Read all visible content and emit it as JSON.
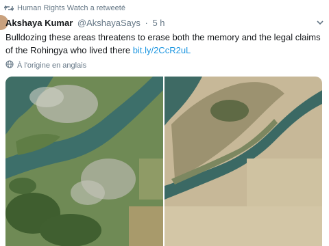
{
  "retweet_context": "Human Rights Watch a retweeté",
  "author": {
    "name": "Akshaya Kumar",
    "handle": "@AkshayaSays",
    "separator": "·",
    "time": "5 h"
  },
  "tweet": {
    "text": "Bulldozing these areas threatens to erase both the memory and the legal claims of the Rohingya who lived there ",
    "link": "bit.ly/2CcR2uL"
  },
  "translation_label": "À l'origine en anglais",
  "media": {
    "images": [
      "satellite-before",
      "satellite-after"
    ]
  },
  "icons": {
    "retweet": "retweet-icon",
    "globe": "globe-icon",
    "chevron": "chevron-down-icon"
  },
  "colors": {
    "link": "#1b95e0",
    "secondary_text": "#657786",
    "primary_text": "#14171a"
  }
}
